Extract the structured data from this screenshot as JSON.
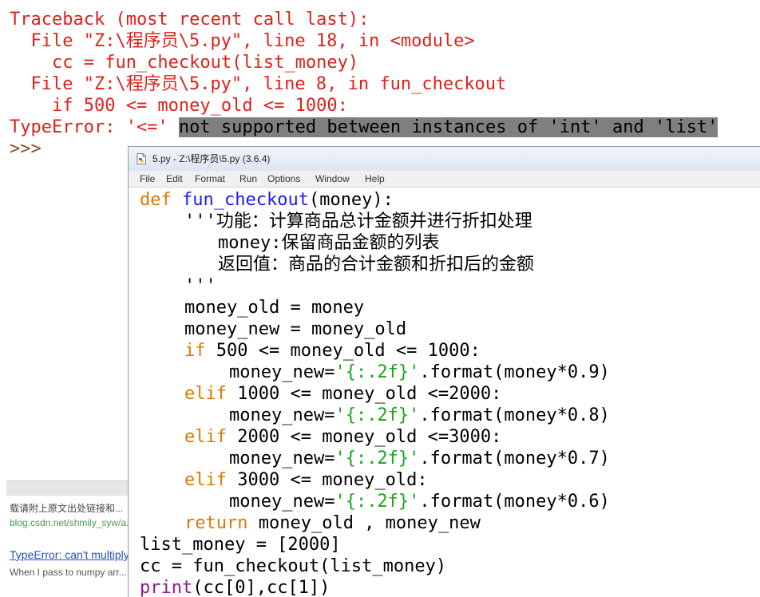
{
  "shell": {
    "traceback_lines": [
      "Traceback (most recent call last):",
      "  File \"Z:\\程序员\\5.py\", line 18, in <module>",
      "    cc = fun_checkout(list_money)",
      "  File \"Z:\\程序员\\5.py\", line 8, in fun_checkout",
      "    if 500 <= money_old <= 1000:"
    ],
    "error_prefix": "TypeError: '<=' ",
    "error_highlight": "not supported between instances of 'int' and 'list'",
    "prompt": ">>>"
  },
  "web_page": {
    "note": "载请附上原文出处链接和...",
    "url": "blog.csdn.net/shmily_syw/a...",
    "link": "TypeError: can't multiply...",
    "snippet": "When I pass to numpy arr..."
  },
  "editor": {
    "title": "5.py - Z:\\程序员\\5.py (3.6.4)",
    "menu": [
      "File",
      "Edit",
      "Format",
      "Run",
      "Options",
      "Window",
      "Help"
    ],
    "code": {
      "l1_def": "def",
      "l1_name": "fun_checkout",
      "l1_rest": "(money):",
      "l2": "'''功能：计算商品总计金额并进行折扣处理",
      "l3": "money:保留商品金额的列表",
      "l4": "返回值：商品的合计金额和折扣后的金额",
      "l5": "'''",
      "l6": "money_old = money",
      "l7": "money_new = money_old",
      "l8_kw": "if",
      "l8_rest": " 500 <= money_old <= 1000:",
      "l9_a": "money_new=",
      "l9_str": "'{:.2f}'",
      "l9_b": ".format(money*0.9)",
      "l10_kw": "elif",
      "l10_rest": " 1000 <= money_old <=2000:",
      "l11_a": "money_new=",
      "l11_str": "'{:.2f}'",
      "l11_b": ".format(money*0.8)",
      "l12_kw": "elif",
      "l12_rest": " 2000 <= money_old <=3000:",
      "l13_a": "money_new=",
      "l13_str": "'{:.2f}'",
      "l13_b": ".format(money*0.7)",
      "l14_kw": "elif",
      "l14_rest": " 3000 <= money_old:",
      "l15_a": "money_new=",
      "l15_str": "'{:.2f}'",
      "l15_b": ".format(money*0.6)",
      "l16_kw": "return",
      "l16_rest": " money_old , money_new",
      "l17": "list_money = [2000]",
      "l18": "cc = fun_checkout(list_money)",
      "l19_bi": "print",
      "l19_rest": "(cc[0],cc[1])"
    }
  },
  "colors": {
    "error_text": "#e0201c",
    "highlight_bg": "#7f7f7f",
    "keyword": "#e07800",
    "def_name": "#1a1aff",
    "string": "#1aa51a",
    "builtin": "#8e1a8e"
  },
  "icons": {
    "window_icon": "python-file-icon"
  }
}
